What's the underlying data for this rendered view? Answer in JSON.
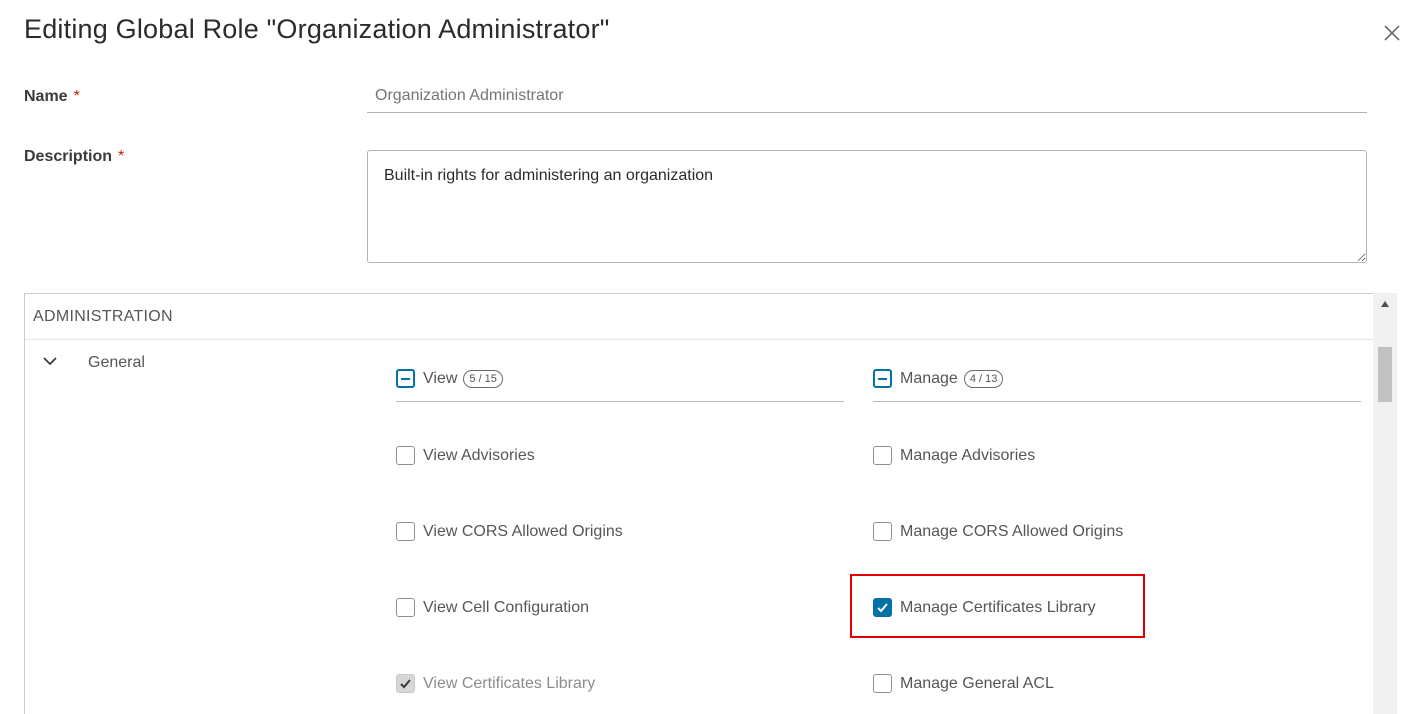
{
  "dialog": {
    "title": "Editing Global Role \"Organization Administrator\"",
    "close_icon": "close-icon"
  },
  "form": {
    "name_label": "Name",
    "name_required": "*",
    "name_placeholder": "Organization Administrator",
    "description_label": "Description",
    "description_required": "*",
    "description_value": "Built-in rights for administering an organization"
  },
  "rights": {
    "section_title": "ADMINISTRATION",
    "group": {
      "label": "General",
      "expanded": true,
      "toggle_icon": "chevron-down-icon"
    },
    "view_column": {
      "label": "View",
      "count": "5 / 15",
      "state": "indeterminate",
      "items": [
        {
          "label": "View Advisories",
          "checked": false,
          "disabled": false
        },
        {
          "label": "View CORS Allowed Origins",
          "checked": false,
          "disabled": false
        },
        {
          "label": "View Cell Configuration",
          "checked": false,
          "disabled": false
        },
        {
          "label": "View Certificates Library",
          "checked": true,
          "disabled": true
        }
      ]
    },
    "manage_column": {
      "label": "Manage",
      "count": "4 / 13",
      "state": "indeterminate",
      "items": [
        {
          "label": "Manage Advisories",
          "checked": false,
          "disabled": false
        },
        {
          "label": "Manage CORS Allowed Origins",
          "checked": false,
          "disabled": false
        },
        {
          "label": "Manage Certificates Library",
          "checked": true,
          "disabled": false
        },
        {
          "label": "Manage General ACL",
          "checked": false,
          "disabled": false
        }
      ]
    }
  },
  "colors": {
    "accent": "#0072a3",
    "required": "#c92100",
    "highlight": "#e00000"
  }
}
